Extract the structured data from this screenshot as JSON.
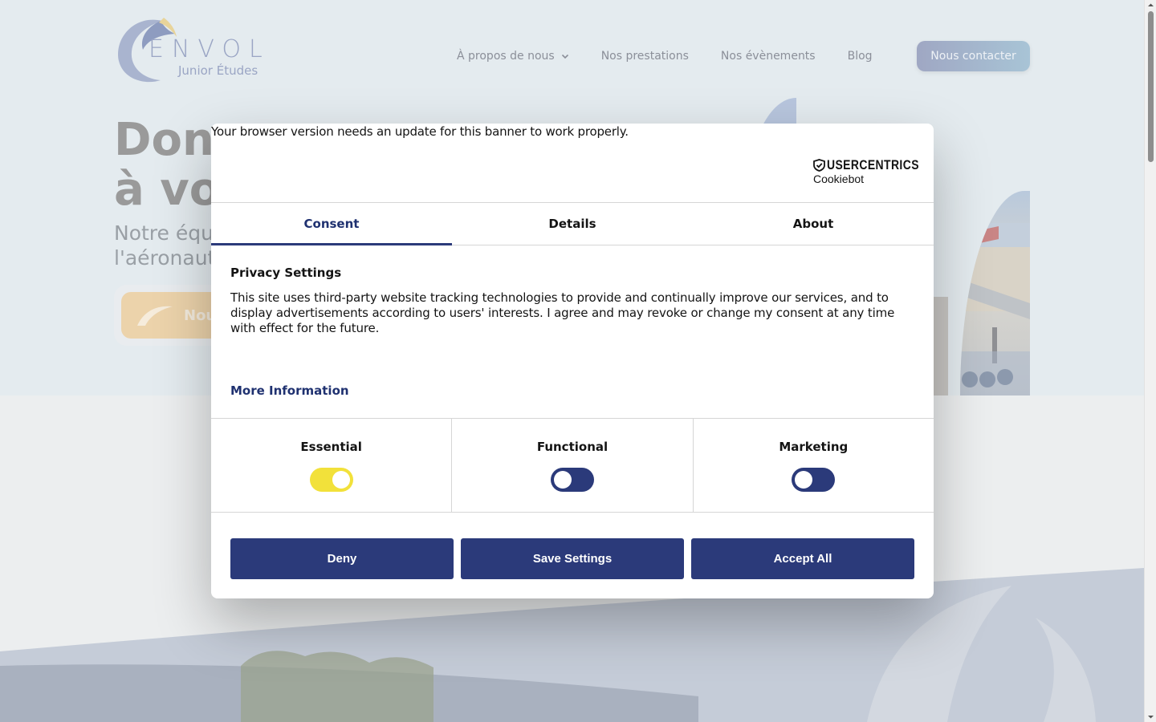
{
  "site": {
    "logo": {
      "title": "ENVOL",
      "subtitle": "Junior Études"
    },
    "nav": {
      "items": [
        {
          "label": "À propos de nous"
        },
        {
          "label": "Nos prestations"
        },
        {
          "label": "Nos évènements"
        },
        {
          "label": "Blog"
        }
      ],
      "cta": "Nous contacter"
    },
    "hero": {
      "title_line1": "Don",
      "title_line2": "à vo",
      "subtitle_line1": "Notre équ",
      "subtitle_line2": "l'aéronaut",
      "button_label": "Nou"
    }
  },
  "cookie_dialog": {
    "browser_warning": "Your browser version needs an update for this banner to work properly.",
    "brand": {
      "name": "USERCENTRICS",
      "product": "Cookiebot"
    },
    "tabs": [
      {
        "label": "Consent",
        "active": true
      },
      {
        "label": "Details",
        "active": false
      },
      {
        "label": "About",
        "active": false
      }
    ],
    "title": "Privacy Settings",
    "body": "This site uses third-party website tracking technologies to provide and continually improve our services, and to display advertisements according to users' interests. I agree and may revoke or change my consent at any time with effect for the future.",
    "more_info": "More Information",
    "toggles": [
      {
        "label": "Essential",
        "state": "on"
      },
      {
        "label": "Functional",
        "state": "off"
      },
      {
        "label": "Marketing",
        "state": "off"
      }
    ],
    "buttons": {
      "deny": "Deny",
      "save": "Save Settings",
      "accept": "Accept All"
    }
  },
  "colors": {
    "accent": "#2b3a7a",
    "toggle_on": "#f2e13a",
    "link": "#1f3170"
  }
}
